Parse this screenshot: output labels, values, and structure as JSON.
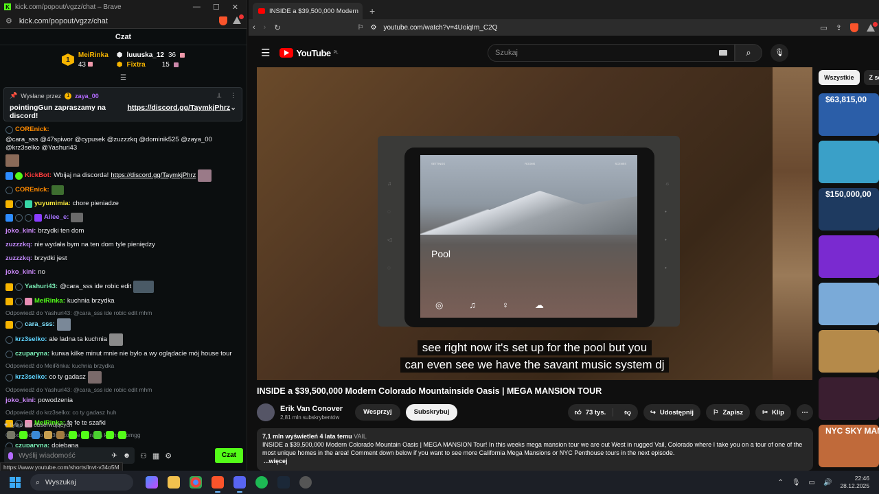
{
  "kick_window": {
    "title": "kick.com/popout/vgzz/chat – Brave",
    "url": "kick.com/popout/vgzz/chat",
    "chat_header": "Czat",
    "leaderboard": {
      "first": {
        "rank": "1",
        "name": "MeiRinka",
        "count": "43"
      },
      "second": {
        "name": "luuuska_12",
        "count": "36"
      },
      "third": {
        "name": "Fixtra",
        "count": "15"
      }
    },
    "pinned": {
      "label": "Wysłane przez",
      "badge": "1",
      "user": "zaya_00",
      "text": "pointingGun zapraszamy na discord!",
      "link": "https://discord.gg/TaymkjPhrz"
    },
    "messages": [
      {
        "user": "COREnick:",
        "color": "#ff8a00",
        "text": "@cara_sss @47spiwor @cypusek @zuzzzkq @dominik525 @zaya_00 @krz3selko @Yashuri43"
      },
      {
        "user": "KickBot:",
        "color": "#ff3d3d",
        "text": "Wbijaj na discorda!",
        "link": "https://discord.gg/TaymkjPhrz"
      },
      {
        "user": "COREnick:",
        "color": "#ff8a00",
        "text": ""
      },
      {
        "user": "yuyumimia:",
        "color": "#f7e73c",
        "text": "chore pieniadze"
      },
      {
        "user": "Ailee_e:",
        "color": "#a774ff",
        "text": ""
      },
      {
        "user": "joko_kini:",
        "color": "#d08cff",
        "text": "brzydki ten dom"
      },
      {
        "user": "zuzzzkq:",
        "color": "#c48aff",
        "text": "nie wydała bym na ten dom tyle pieniędzy"
      },
      {
        "user": "zuzzzkq:",
        "color": "#c48aff",
        "text": "brzydki jest"
      },
      {
        "user": "joko_kini:",
        "color": "#d08cff",
        "text": "no"
      },
      {
        "user": "Yashuri43:",
        "color": "#7cf0b8",
        "text": "@cara_sss ide robic edit"
      },
      {
        "user": "MeiRinka:",
        "color": "#53fc18",
        "text": "kuchnia brzydka"
      },
      {
        "reply": "Odpowiedź do Yashuri43: @cara_sss ide robic edit mhm",
        "user": "cara_sss:",
        "color": "#7fe3ff",
        "text": ""
      },
      {
        "user": "krz3selko:",
        "color": "#5fd4ff",
        "text": "ale ladna ta kuchnia"
      },
      {
        "user": "czuparyna:",
        "color": "#7cf0b8",
        "text": "kurwa kilke minut mnie nie było a wy oglądacie mój house tour"
      },
      {
        "reply": "Odpowiedź do MeiRinka: kuchnia brzydka",
        "user": "krz3selko:",
        "color": "#5fd4ff",
        "text": "co ty gadasz"
      },
      {
        "reply": "Odpowiedź do Yashuri43: @cara_sss ide robic edit mhm",
        "user": "joko_kini:",
        "color": "#d08cff",
        "text": "powodzenia"
      },
      {
        "reply": "Odpowiedź do krz3selko: co ty gadasz huh",
        "user": "MeiRinka:",
        "color": "#53fc18",
        "text": "fe fe te szafki"
      },
      {
        "reply": "Odpowiedź do krz3selko: ale ladna ta kuchnia omgg",
        "user": "czuparyna:",
        "color": "#7cf0b8",
        "text": "dojebana"
      }
    ],
    "followers_only": "Tylko dla obserwujących",
    "input_placeholder": "Wyślij wiadomość",
    "send_label": "Czat",
    "status_url": "https://www.youtube.com/shorts/lnvt-v34o5M"
  },
  "yt_window": {
    "tab_title": "INSIDE a $39,500,000 Modern",
    "url": "youtube.com/watch?v=4UoiqIm_C2Q",
    "search_placeholder": "Szukaj",
    "logo_text": "YouTube",
    "logo_region": "PL",
    "video": {
      "screen_menu": [
        "SETTINGS",
        "ROOMS",
        "SCENES"
      ],
      "screen_label": "Pool",
      "subtitle_line1": "see right now it's set up for the pool but you",
      "subtitle_line2": "can even see we have the savant music system dj"
    },
    "title": "INSIDE a $39,500,000 Modern Colorado Mountainside Oasis | MEGA MANSION TOUR",
    "channel": {
      "name": "Erik Van Conover",
      "subs": "2,81 mln subskrybentów"
    },
    "join_label": "Wesprzyj",
    "subscribe_label": "Subskrybuj",
    "likes": "73 tys.",
    "share_label": "Udostępnij",
    "save_label": "Zapisz",
    "clip_label": "Klip",
    "description": {
      "views": "7,1 mln wyświetleń",
      "age": "4 lata temu",
      "tag": "VAIL",
      "text": "INSIDE a $39,500,000 Modern Colorado Mountain Oasis | MEGA MANSION Tour! In this weeks mega mansion tour we are out West in rugged Vail, Colorado where I take you on a tour of one of the most unique homes in the area! Comment down below if you want to see more California Mega Mansions or NYC Penthouse tours in the next episode.",
      "more": "...więcej"
    },
    "chips": [
      "Wszystkie",
      "Z se"
    ],
    "recommendations": [
      {
        "title": "$63,815,00",
        "color": "#2b5ea8"
      },
      {
        "title": "",
        "color": "#3aa0c8"
      },
      {
        "title": "$150,000,00",
        "color": "#1e3a60"
      },
      {
        "title": "",
        "color": "#7a2ad0"
      },
      {
        "title": "",
        "color": "#7aaad8"
      },
      {
        "title": "",
        "color": "#b58a4a"
      },
      {
        "title": "",
        "color": "#3a1e30"
      },
      {
        "title": "NYC SKY MANS",
        "color": "#c06a3a"
      }
    ]
  },
  "taskbar": {
    "search_label": "Wyszukaj",
    "time": "22:46",
    "date": "28.12.2025"
  }
}
